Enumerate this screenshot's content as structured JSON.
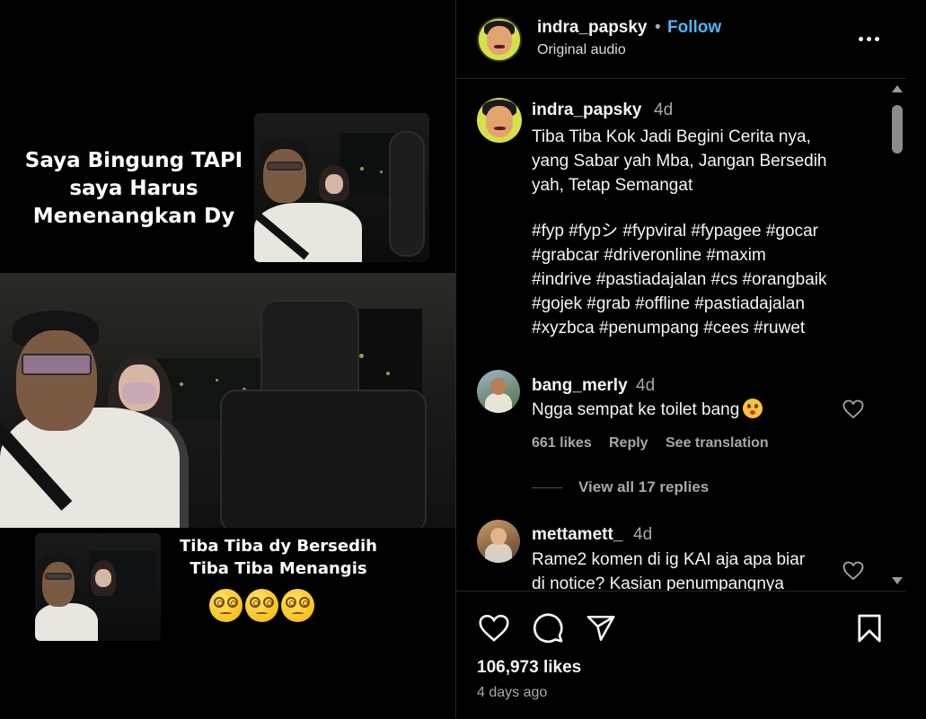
{
  "media": {
    "overlay_top": [
      "Saya Bingung TAPI",
      "saya Harus",
      "Menenangkan Dy"
    ],
    "overlay_bottom": [
      "Tiba Tiba dy Bersedih",
      "Tiba Tiba Menangis"
    ],
    "emoji_icons": [
      "dizzy-face-icon",
      "dizzy-face-icon",
      "dizzy-face-icon"
    ]
  },
  "header": {
    "username": "indra_papsky",
    "separator": "•",
    "follow_label": "Follow",
    "audio": "Original audio"
  },
  "caption": {
    "username": "indra_papsky",
    "time": "4d",
    "text_lines": [
      "Tiba Tiba Kok Jadi Begini Cerita nya,",
      "yang Sabar yah Mba, Jangan Bersedih",
      "yah, Tetap Semangat"
    ],
    "hashtag_lines": [
      "#fyp #fypシ #fypviral #fypagee #gocar",
      "#grabcar #driveronline #maxim",
      "#indrive #pastiadajalan #cs #orangbaik",
      "#gojek #grab #offline #pastiadajalan",
      "#xyzbca #penumpang #cees #ruwet"
    ]
  },
  "comments": [
    {
      "username": "bang_merly",
      "time": "4d",
      "text": "Ngga sempat ke toilet bang",
      "emoji": "pleading-face-icon",
      "likes": "661 likes",
      "reply": "Reply",
      "translate": "See translation",
      "view_replies": "View all 17 replies"
    },
    {
      "username": "mettamett_",
      "time": "4d",
      "text_lines": [
        "Rame2 komen di ig KAI aja apa biar",
        "di notice? Kasian penumpangnya"
      ]
    }
  ],
  "footer": {
    "likes": "106,973 likes",
    "age": "4 days ago"
  },
  "colors": {
    "background": "#000000",
    "accent_follow": "#4cb5f9",
    "muted_text": "#a8a8a8",
    "divider": "#262626"
  }
}
